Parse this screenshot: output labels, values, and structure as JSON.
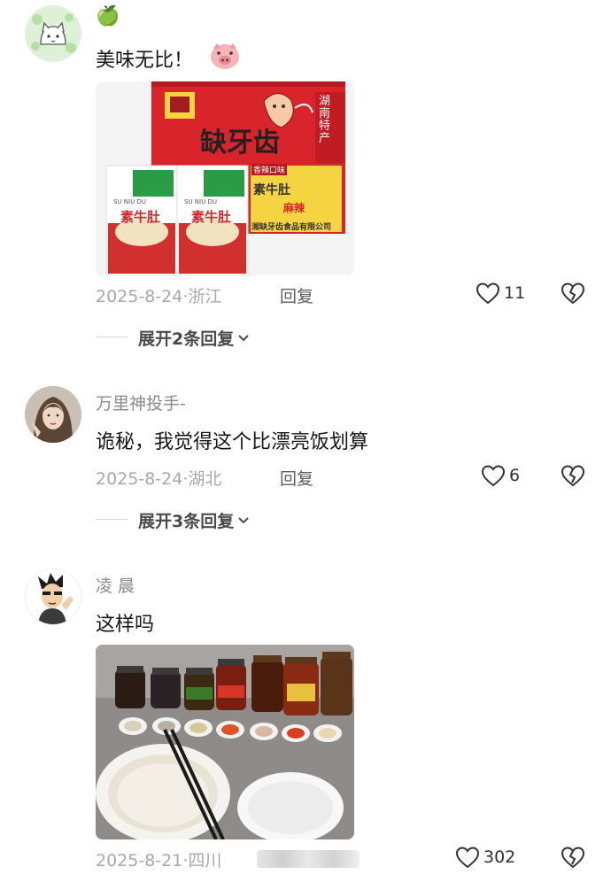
{
  "comments": [
    {
      "username": "",
      "username_emoji": "🍏",
      "text": "美味无比！",
      "text_emoji": "pig-face",
      "image": {
        "kind": "product-photo",
        "box_title": "缺牙齿",
        "box_side": "湖南特产",
        "box_product": "素牛肚",
        "box_tag1": "香辣口味",
        "box_tag2": "麻辣",
        "box_footer": "湘缺牙齿食品有限公司",
        "pack_label": "素牛肚",
        "pack_pinyin": "SU NIU DU"
      },
      "date": "2025-8-24",
      "location": "浙江",
      "reply_label": "回复",
      "likes": "11",
      "expand_label": "展开2条回复",
      "colors": {
        "box": "#d8242a",
        "box_yellow": "#f4d440"
      }
    },
    {
      "username": "万里神投手-",
      "text": "诡秘，我觉得这个比漂亮饭划算",
      "date": "2025-8-24",
      "location": "湖北",
      "reply_label": "回复",
      "likes": "6",
      "expand_label": "展开3条回复"
    },
    {
      "username": "凌 晨",
      "text": "这样吗",
      "image": {
        "kind": "food-photo"
      },
      "date": "2025-8-21",
      "location": "四川",
      "likes": "302"
    }
  ],
  "icons": {
    "like": "heart-outline-icon",
    "dislike": "broken-heart-icon",
    "chevron": "chevron-down-icon"
  }
}
